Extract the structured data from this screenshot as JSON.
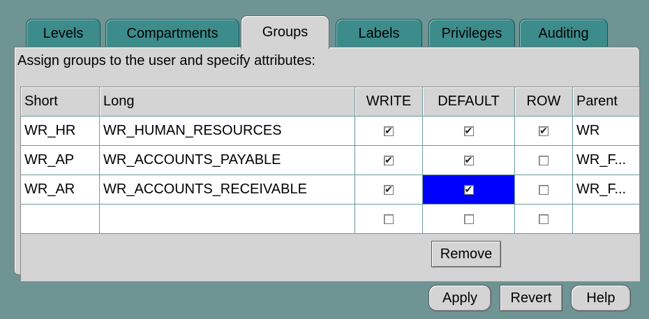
{
  "tabs": [
    {
      "label": "Levels"
    },
    {
      "label": "Compartments"
    },
    {
      "label": "Groups"
    },
    {
      "label": "Labels"
    },
    {
      "label": "Privileges"
    },
    {
      "label": "Auditing"
    }
  ],
  "active_tab": "Groups",
  "instruction": "Assign groups to the user and specify attributes:",
  "table": {
    "columns": [
      "Short",
      "Long",
      "WRITE",
      "DEFAULT",
      "ROW",
      "Parent"
    ],
    "rows": [
      {
        "short": "WR_HR",
        "long": "WR_HUMAN_RESOURCES",
        "write": true,
        "default": true,
        "row": true,
        "parent": "WR"
      },
      {
        "short": "WR_AP",
        "long": "WR_ACCOUNTS_PAYABLE",
        "write": true,
        "default": true,
        "row": false,
        "parent": "WR_F..."
      },
      {
        "short": "WR_AR",
        "long": "WR_ACCOUNTS_RECEIVABLE",
        "write": true,
        "default": true,
        "row": false,
        "parent": "WR_F..."
      },
      {
        "short": "",
        "long": "",
        "write": false,
        "default": false,
        "row": false,
        "parent": ""
      }
    ],
    "selected_cell": "row 3 DEFAULT"
  },
  "buttons": {
    "remove": "Remove",
    "apply": "Apply",
    "revert": "Revert",
    "help": "Help"
  },
  "colors": {
    "background": "#6e9494",
    "tab": "#3c8c8c",
    "panel": "#d4d4d4",
    "selection": "#0000ff"
  }
}
